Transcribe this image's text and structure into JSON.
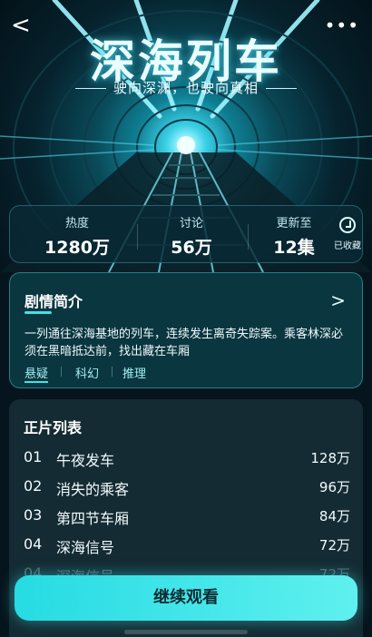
{
  "header": {
    "title": "深海列车",
    "subtitle": "驶向深渊，也驶向真相",
    "back_icon": "chevron-left-icon",
    "more_icon": "more-dots-icon",
    "more_glyph": "•••",
    "back_glyph": "<"
  },
  "stats": {
    "heat": {
      "label": "热度",
      "value": "1280万"
    },
    "discuss": {
      "label": "讨论",
      "value": "56万"
    },
    "updated": {
      "label": "更新至",
      "value": "12集"
    },
    "favorite_label": "已收藏"
  },
  "synopsis": {
    "title": "剧情简介",
    "text": "一列通往深海基地的列车，连续发生离奇失踪案。乘客林深必须在黑暗抵达前，找出藏在车厢",
    "tags": [
      "悬疑",
      "科幻",
      "推理"
    ],
    "active_tag": "悬疑",
    "chevron": ">"
  },
  "episodes": {
    "title": "正片列表",
    "items": [
      {
        "no": "01",
        "name": "午夜发车",
        "count": "128万"
      },
      {
        "no": "02",
        "name": "消失的乘客",
        "count": "96万"
      },
      {
        "no": "03",
        "name": "第四节车厢",
        "count": "84万"
      },
      {
        "no": "04",
        "name": "深海信号",
        "count": "72万"
      },
      {
        "no": "04",
        "name": "深海信号",
        "count": "72万"
      }
    ]
  },
  "cta": {
    "label": "继续观看"
  },
  "colors": {
    "accent": "#3fe3e6",
    "background": "#06151d",
    "cta": "#3ee6e8"
  }
}
